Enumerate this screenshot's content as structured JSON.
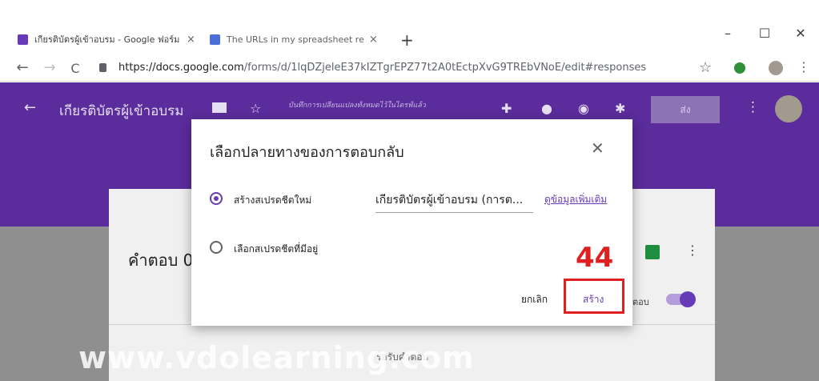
{
  "browser": {
    "tabs": [
      {
        "title": "เกียรติบัตรผู้เข้าอบรม - Google ฟอร์ม",
        "close": "×"
      },
      {
        "title": "The URLs in my spreadsheet resp",
        "close": "×"
      }
    ],
    "new_tab": "+",
    "window_controls": {
      "minimize": "–",
      "maximize": "☐",
      "close": "✕"
    },
    "nav": {
      "back": "←",
      "forward": "→",
      "reload": "C"
    },
    "url_host": "https://docs.google.com",
    "url_path": "/forms/d/1lqDZjeleE37kIZTgrEPZ77t2A0tEctpXvG9TREbVNoE/edit#responses",
    "bookmark_icon": "☆",
    "menu_icon": "⋮"
  },
  "forms_header": {
    "back_icon": "←",
    "title": "เกียรติบัตรผู้เข้าอบรม",
    "save_note": "บันทึกการเปลี่ยนแปลงทั้งหมดไว้ในไดรฟ์แล้ว",
    "send_label": "ส่ง",
    "menu_icon": "⋮"
  },
  "responses_card": {
    "title": "คำตอบ 0",
    "accepting_label": "ตอบ",
    "no_responses": "รอรับคำตอบ"
  },
  "dialog": {
    "title": "เลือกปลายทางของการตอบกลับ",
    "close_icon": "✕",
    "option_new": "สร้างสเปรดชีตใหม่",
    "option_existing": "เลือกสเปรดชีตที่มีอยู่",
    "sheet_name": "เกียรติบัตรผู้เข้าอบรม (การต...",
    "learn_more": "ดูข้อมูลเพิ่มเติม",
    "cancel_label": "ยกเลิก",
    "create_label": "สร้าง"
  },
  "annotation": {
    "step_number": "44",
    "watermark": "www.vdolearning.com"
  },
  "colors": {
    "forms_purple": "#5b2c9c",
    "accent": "#673ab7",
    "highlight_red": "#e02020"
  }
}
